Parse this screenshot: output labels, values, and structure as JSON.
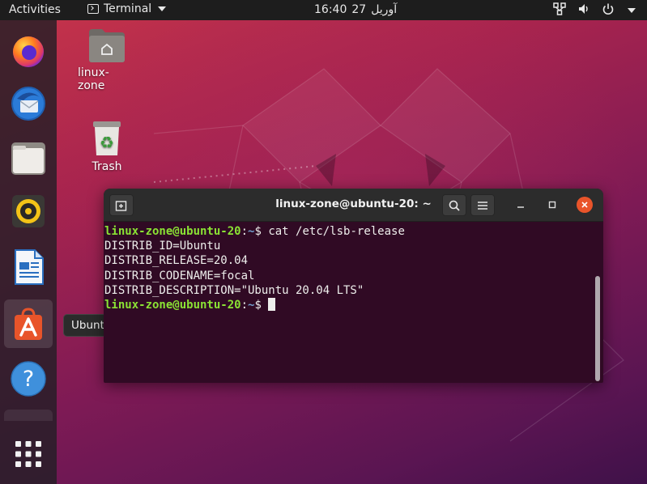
{
  "topbar": {
    "activities": "Activities",
    "app_name": "Terminal",
    "clock_day": "27",
    "clock_month": "آوریل",
    "clock_time": "16:40"
  },
  "desktop": {
    "home_label": "linux-zone",
    "trash_label": "Trash"
  },
  "dock": {
    "items": [
      "Firefox",
      "Thunderbird Mail",
      "Files",
      "Rhythmbox",
      "LibreOffice Writer",
      "Ubuntu Software",
      "Help",
      "Show Applications"
    ],
    "tooltip": "Ubuntu Software"
  },
  "terminal": {
    "title": "linux-zone@ubuntu-20: ~",
    "prompt_user": "linux-zone@ubuntu-20",
    "prompt_colon": ":",
    "prompt_path": "~",
    "prompt_dollar": "$",
    "command": " cat /etc/lsb-release",
    "output": [
      "DISTRIB_ID=Ubuntu",
      "DISTRIB_RELEASE=20.04",
      "DISTRIB_CODENAME=focal",
      "DISTRIB_DESCRIPTION=\"Ubuntu 20.04 LTS\""
    ]
  },
  "colors": {
    "terminal_bg": "#300a24",
    "prompt_user": "#8ae234",
    "prompt_path": "#729fcf",
    "close_button": "#e9542a",
    "topbar_bg": "#1d1d1d"
  }
}
